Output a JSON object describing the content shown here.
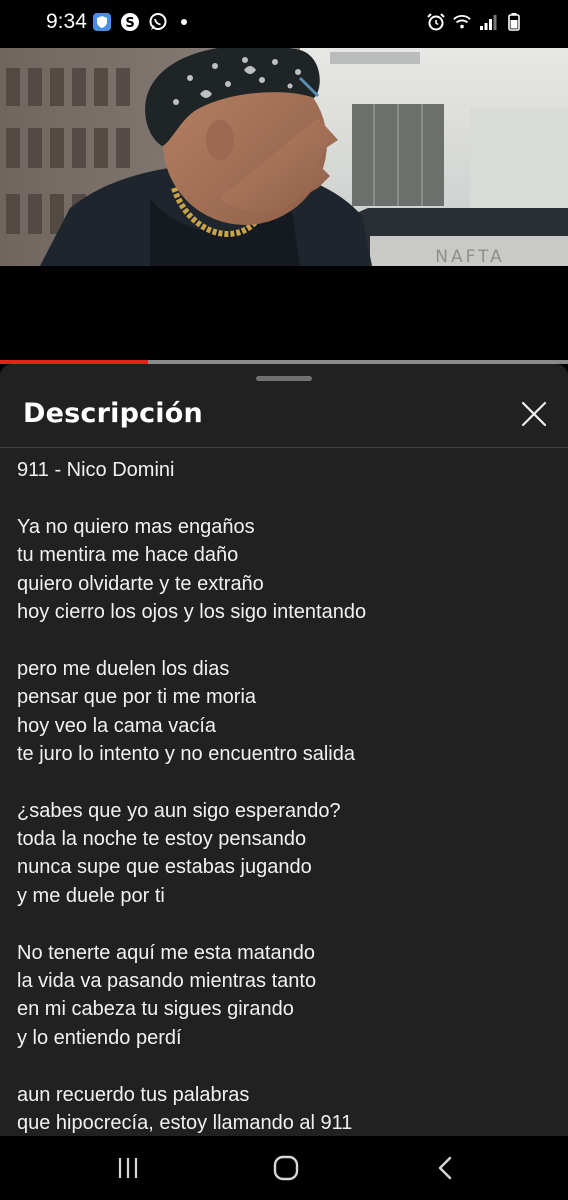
{
  "status_bar": {
    "time": "9:34",
    "left_icons": [
      "shield-app-icon",
      "s-circle-icon",
      "whatsapp-icon",
      "notification-dot-icon"
    ],
    "right_icons": [
      "alarm-icon",
      "wifi-icon",
      "signal-icon",
      "battery-icon"
    ]
  },
  "video": {
    "sign_text": "NAFTA",
    "progress": 0.26,
    "progress_color": "#e62117"
  },
  "description_panel": {
    "title": "Descripción",
    "video_title": "911 - Nico Domini",
    "stanzas": [
      [
        "Ya no quiero mas engaños",
        "tu mentira me hace daño",
        "quiero olvidarte y te extraño",
        "hoy cierro los ojos y los sigo intentando"
      ],
      [
        "pero me duelen los dias",
        "pensar que por ti me moria",
        "hoy veo la cama vacía",
        "te juro lo intento y no encuentro salida"
      ],
      [
        "¿sabes que yo aun sigo esperando?",
        "toda la noche te estoy pensando",
        "nunca supe que estabas jugando",
        "y me duele por ti"
      ],
      [
        "No tenerte aquí me esta matando",
        "la vida va pasando mientras tanto",
        "en mi cabeza tu sigues girando",
        "y lo entiendo perdí"
      ],
      [
        "aun recuerdo tus palabras",
        "que hipocrecía, estoy llamando al 911"
      ]
    ]
  },
  "nav_bar": {
    "buttons": [
      "recent-apps-icon",
      "home-icon",
      "back-icon"
    ]
  }
}
